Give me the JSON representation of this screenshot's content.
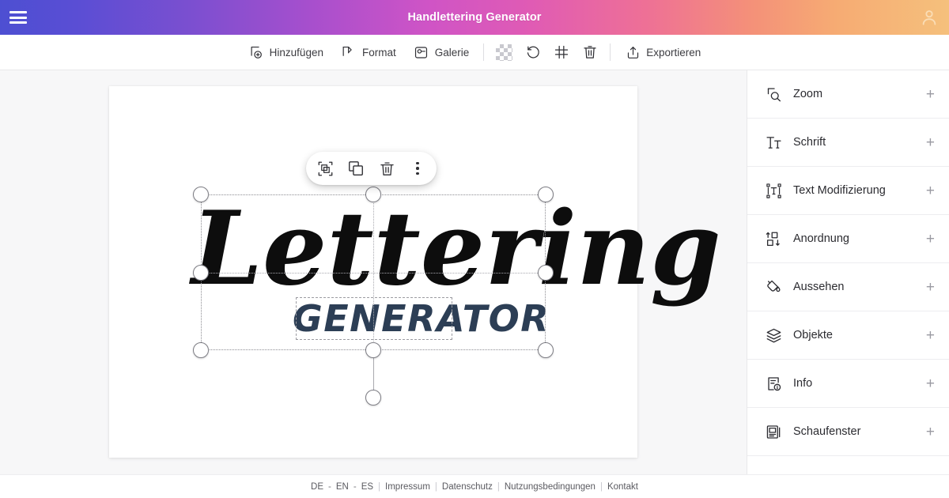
{
  "header": {
    "title": "Handlettering Generator",
    "menu_icon": "hamburger-menu-icon",
    "account_icon": "user-account-icon",
    "gradient_start": "#4d4fd2",
    "gradient_mid": "#cf54c6",
    "gradient_end": "#f5c07c"
  },
  "toolbar": {
    "items": [
      {
        "label": "Hinzufügen",
        "icon": "add-element-icon"
      },
      {
        "label": "Format",
        "icon": "format-icon"
      },
      {
        "label": "Galerie",
        "icon": "gallery-icon"
      }
    ],
    "transparency": {
      "label": "",
      "icon": "transparency-checker-icon"
    },
    "undo": {
      "label": "",
      "icon": "undo-icon"
    },
    "grid": {
      "label": "",
      "icon": "grid-icon"
    },
    "delete": {
      "label": "",
      "icon": "trash-icon"
    },
    "export": {
      "label": "Exportieren",
      "icon": "export-icon"
    }
  },
  "context_toolbar": {
    "buttons": [
      {
        "icon": "group-select-icon"
      },
      {
        "icon": "duplicate-icon"
      },
      {
        "icon": "trash-icon"
      },
      {
        "icon": "more-options-icon"
      }
    ]
  },
  "canvas": {
    "artwork": {
      "headline": "Lettering",
      "headline_color": "#0d0d0d",
      "subline": "GENERATOR",
      "subline_color": "#2c3e55",
      "background": "#ffffff"
    },
    "selection": {
      "handles": 8,
      "rotation_handle": true,
      "sub_selection_label": "GENERATOR"
    }
  },
  "sidebar": {
    "items": [
      {
        "label": "Zoom",
        "icon": "zoom-icon",
        "expander": "+"
      },
      {
        "label": "Schrift",
        "icon": "font-icon",
        "expander": "+"
      },
      {
        "label": "Text Modifizierung",
        "icon": "text-modify-icon",
        "expander": "+"
      },
      {
        "label": "Anordnung",
        "icon": "arrange-icon",
        "expander": "+"
      },
      {
        "label": "Aussehen",
        "icon": "appearance-fill-icon",
        "expander": "+"
      },
      {
        "label": "Objekte",
        "icon": "layers-icon",
        "expander": "+"
      },
      {
        "label": "Info",
        "icon": "info-document-icon",
        "expander": "+"
      },
      {
        "label": "Schaufenster",
        "icon": "showcase-icon",
        "expander": "+"
      }
    ]
  },
  "footer": {
    "languages": [
      {
        "label": "DE"
      },
      {
        "label": "EN"
      },
      {
        "label": "ES"
      }
    ],
    "lang_dash": "-",
    "separator": "|",
    "links": [
      {
        "label": "Impressum"
      },
      {
        "label": "Datenschutz"
      },
      {
        "label": "Nutzungsbedingungen"
      },
      {
        "label": "Kontakt"
      }
    ]
  }
}
